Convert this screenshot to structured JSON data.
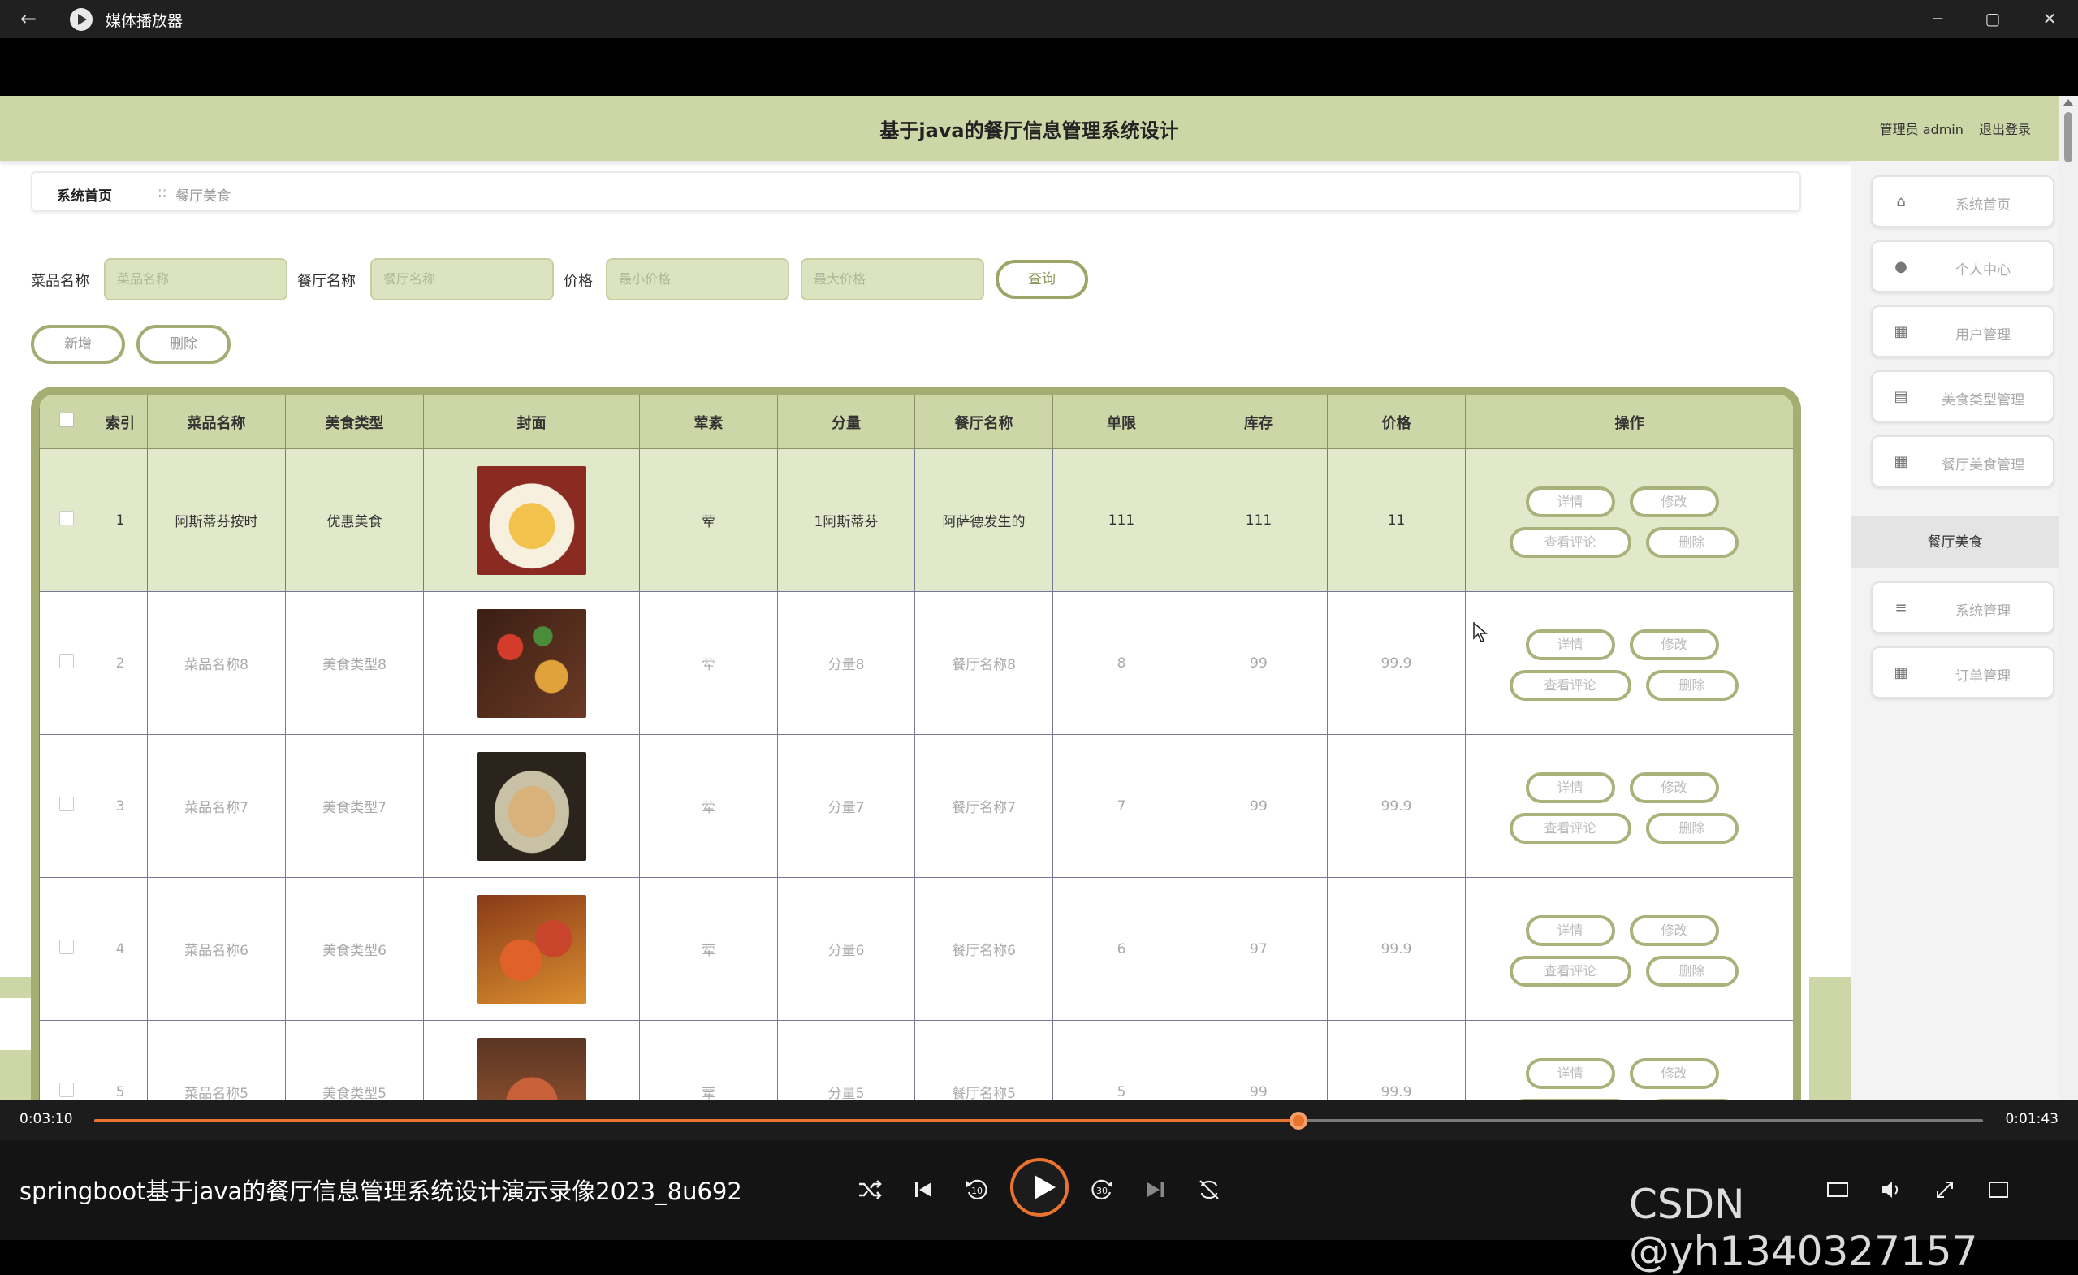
{
  "window": {
    "title": "媒体播放器",
    "back_icon": "←",
    "min_icon": "─",
    "max_icon": "▢",
    "close_icon": "✕"
  },
  "app": {
    "title": "基于java的餐厅信息管理系统设计",
    "user_role": "管理员 admin",
    "logout": "退出登录"
  },
  "breadcrumb": {
    "home": "系统首页",
    "separator": "::",
    "current": "餐厅美食"
  },
  "search": {
    "dish_label": "菜品名称",
    "dish_placeholder": "菜品名称",
    "restaurant_label": "餐厅名称",
    "restaurant_placeholder": "餐厅名称",
    "price_label": "价格",
    "min_price_placeholder": "最小价格",
    "max_price_placeholder": "最大价格",
    "query_button": "查询"
  },
  "actions": {
    "add_button": "新增",
    "delete_button": "删除"
  },
  "table": {
    "columns": [
      "索引",
      "菜品名称",
      "美食类型",
      "封面",
      "荤素",
      "分量",
      "餐厅名称",
      "单限",
      "库存",
      "价格",
      "操作"
    ],
    "rows": [
      {
        "index": "1",
        "name": "阿斯蒂芬按时",
        "type": "优惠美食",
        "meat": "荤",
        "portion": "1阿斯蒂芬",
        "restaurant": "阿萨德发生的",
        "limit": "111",
        "stock": "111",
        "price": "11"
      },
      {
        "index": "2",
        "name": "菜品名称8",
        "type": "美食类型8",
        "meat": "荤",
        "portion": "分量8",
        "restaurant": "餐厅名称8",
        "limit": "8",
        "stock": "99",
        "price": "99.9"
      },
      {
        "index": "3",
        "name": "菜品名称7",
        "type": "美食类型7",
        "meat": "荤",
        "portion": "分量7",
        "restaurant": "餐厅名称7",
        "limit": "7",
        "stock": "99",
        "price": "99.9"
      },
      {
        "index": "4",
        "name": "菜品名称6",
        "type": "美食类型6",
        "meat": "荤",
        "portion": "分量6",
        "restaurant": "餐厅名称6",
        "limit": "6",
        "stock": "97",
        "price": "99.9"
      },
      {
        "index": "5",
        "name": "菜品名称5",
        "type": "美食类型5",
        "meat": "荤",
        "portion": "分量5",
        "restaurant": "餐厅名称5",
        "limit": "5",
        "stock": "99",
        "price": "99.9"
      }
    ],
    "row_buttons": {
      "detail": "详情",
      "edit": "修改",
      "reviews": "查看评论",
      "delete": "删除"
    }
  },
  "sidebar": {
    "items": [
      {
        "label": "系统首页",
        "icon": "home-icon",
        "glyph": "⌂"
      },
      {
        "label": "个人中心",
        "icon": "user-icon",
        "glyph": "●"
      },
      {
        "label": "用户管理",
        "icon": "grid-icon",
        "glyph": "▦"
      },
      {
        "label": "美食类型管理",
        "icon": "clipboard-icon",
        "glyph": "▤"
      },
      {
        "label": "餐厅美食管理",
        "icon": "grid-icon",
        "glyph": "▦"
      },
      {
        "label": "餐厅美食",
        "icon": "",
        "glyph": "",
        "active": true
      },
      {
        "label": "系统管理",
        "icon": "menu-icon",
        "glyph": "≡"
      },
      {
        "label": "订单管理",
        "icon": "grid-icon",
        "glyph": "▦"
      }
    ]
  },
  "player": {
    "elapsed": "0:03:10",
    "remaining": "0:01:43",
    "progress": 0.6375,
    "video_title": "springboot基于java的餐厅信息管理系统设计演示录像2023_8u692",
    "accent_color": "#e8742d"
  },
  "watermark": "CSDN @yh1340327157",
  "colors": {
    "header_green": "#ccd6a6",
    "table_border": "#a5ad72"
  }
}
